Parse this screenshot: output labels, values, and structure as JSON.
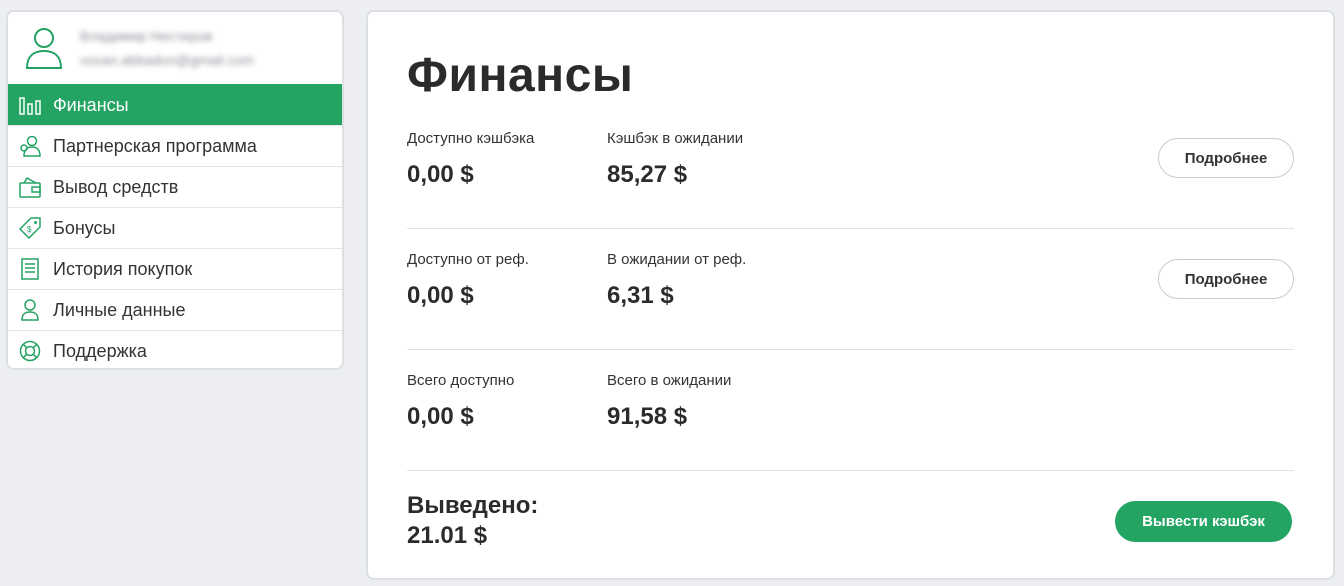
{
  "profile": {
    "name": "Владимир Нестеров",
    "email": "vovan.abbadon@gmail.com"
  },
  "sidebar": {
    "items": [
      {
        "label": "Финансы",
        "icon": "chart-bars-icon",
        "active": true
      },
      {
        "label": "Партнерская программа",
        "icon": "partners-icon",
        "active": false
      },
      {
        "label": "Вывод средств",
        "icon": "wallet-icon",
        "active": false
      },
      {
        "label": "Бонусы",
        "icon": "price-tag-icon",
        "active": false
      },
      {
        "label": "История покупок",
        "icon": "document-list-icon",
        "active": false
      },
      {
        "label": "Личные данные",
        "icon": "user-icon",
        "active": false
      },
      {
        "label": "Поддержка",
        "icon": "lifebuoy-icon",
        "active": false
      }
    ]
  },
  "main": {
    "title": "Финансы",
    "rows": [
      {
        "left": {
          "label": "Доступно кэшбэка",
          "value": "0,00 $"
        },
        "right": {
          "label": "Кэшбэк в ожидании",
          "value": "85,27 $"
        },
        "button": "Подробнее"
      },
      {
        "left": {
          "label": "Доступно от реф.",
          "value": "0,00 $"
        },
        "right": {
          "label": "В ожидании от реф.",
          "value": "6,31 $"
        },
        "button": "Подробнее"
      },
      {
        "left": {
          "label": "Всего доступно",
          "value": "0,00 $"
        },
        "right": {
          "label": "Всего в ожидании",
          "value": "91,58 $"
        }
      }
    ],
    "withdrawn": {
      "label": "Выведено:",
      "value": "21.01 $"
    },
    "withdraw_button": "Вывести кэшбэк"
  },
  "colors": {
    "accent": "#24a463",
    "background": "#eceef1",
    "text": "#2b2b2b"
  }
}
